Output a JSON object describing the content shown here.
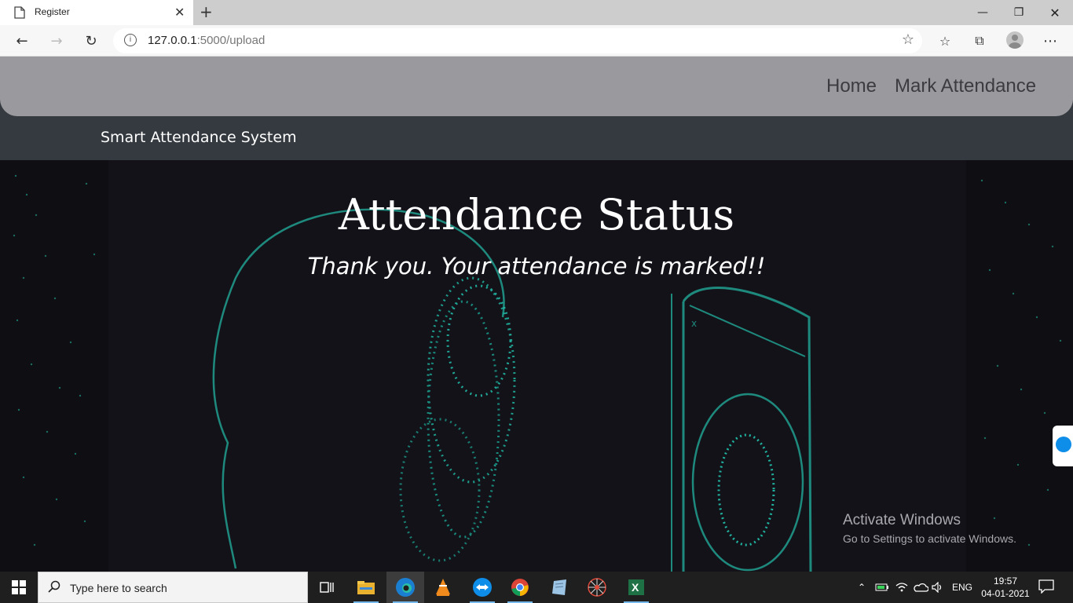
{
  "browser": {
    "tab_title": "Register",
    "url_host": "127.0.0.1",
    "url_rest": ":5000/upload"
  },
  "nav": {
    "links": [
      "Home",
      "Mark Attendance"
    ]
  },
  "brand": "Smart Attendance System",
  "hero": {
    "title": "Attendance Status",
    "message": "Thank you. Your attendance is marked!!"
  },
  "watermark": {
    "title": "Activate Windows",
    "subtitle": "Go to Settings to activate Windows."
  },
  "taskbar": {
    "search_placeholder": "Type here to search",
    "language": "ENG",
    "time": "19:57",
    "date": "04-01-2021"
  },
  "colors": {
    "navbar": "#9a9a9e",
    "brandbar": "#343a40",
    "hero_bg": "#141219",
    "accent_teal": "#1fb3a0"
  }
}
